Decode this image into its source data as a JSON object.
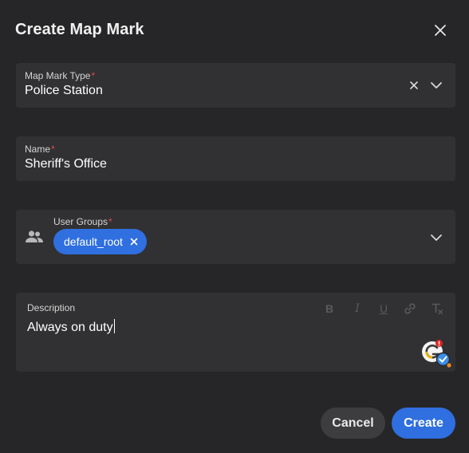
{
  "dialog": {
    "title": "Create Map Mark"
  },
  "fields": {
    "type": {
      "label": "Map Mark Type",
      "required": "*",
      "value": "Police Station"
    },
    "name": {
      "label": "Name",
      "required": "*",
      "value": "Sheriff's Office"
    },
    "groups": {
      "label": "User Groups",
      "required": "*",
      "chips": [
        "default_root"
      ]
    },
    "description": {
      "label": "Description",
      "value": "Always on duty",
      "toolbar": {
        "bold": "B",
        "italic": "I",
        "underline": "U",
        "clear": "Tx"
      }
    }
  },
  "buttons": {
    "cancel": "Cancel",
    "create": "Create"
  },
  "icons": {
    "close": "close-icon",
    "clear": "clear-icon",
    "chevron": "chevron-down-icon",
    "people": "people-icon",
    "link": "link-icon",
    "grammar": "grammar-checker-icon"
  },
  "colors": {
    "background": "#262628",
    "field": "#313133",
    "accent": "#2f6fe0",
    "required": "#e5484d",
    "secondary_button": "#3d3d40"
  }
}
